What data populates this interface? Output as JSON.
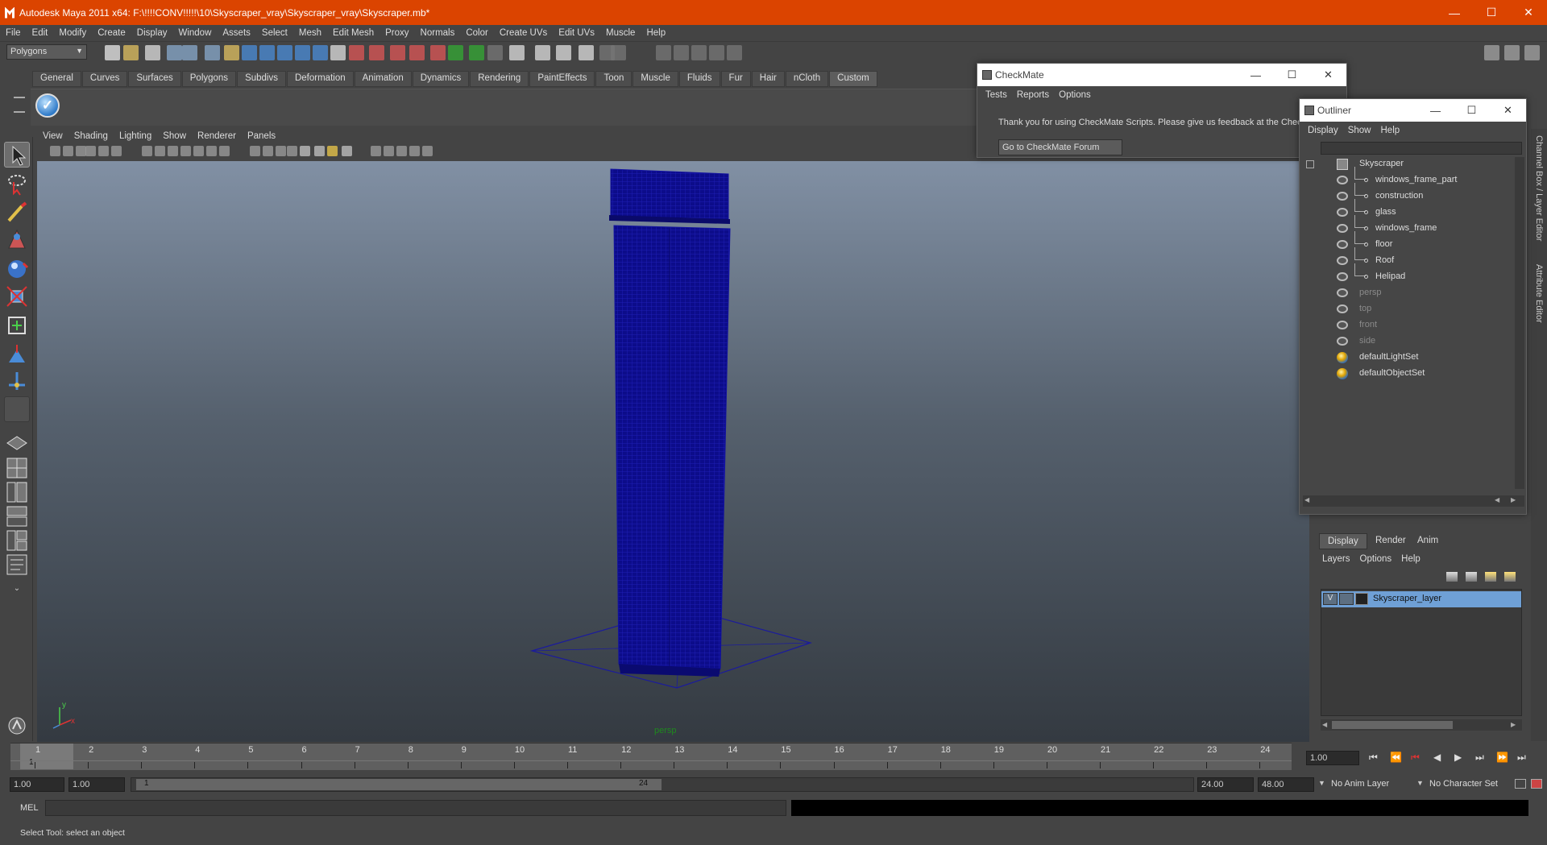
{
  "titlebar": {
    "title": "Autodesk Maya 2011 x64: F:\\!!!!CONV!!!!!\\10\\Skyscraper_vray\\Skyscraper_vray\\Skyscraper.mb*"
  },
  "menubar": [
    "File",
    "Edit",
    "Modify",
    "Create",
    "Display",
    "Window",
    "Assets",
    "Select",
    "Mesh",
    "Edit Mesh",
    "Proxy",
    "Normals",
    "Color",
    "Create UVs",
    "Edit UVs",
    "Muscle",
    "Help"
  ],
  "mode_combo": "Polygons",
  "shelf_tabs": [
    "General",
    "Curves",
    "Surfaces",
    "Polygons",
    "Subdivs",
    "Deformation",
    "Animation",
    "Dynamics",
    "Rendering",
    "PaintEffects",
    "Toon",
    "Muscle",
    "Fluids",
    "Fur",
    "Hair",
    "nCloth",
    "Custom"
  ],
  "shelf_active": "Custom",
  "panel_menu": [
    "View",
    "Shading",
    "Lighting",
    "Show",
    "Renderer",
    "Panels"
  ],
  "viewport": {
    "camera_label": "persp",
    "axis_y": "y",
    "axis_x": "x"
  },
  "timeline": {
    "frames": [
      "1",
      "2",
      "3",
      "4",
      "5",
      "6",
      "7",
      "8",
      "9",
      "10",
      "11",
      "12",
      "13",
      "14",
      "15",
      "16",
      "17",
      "18",
      "19",
      "20",
      "21",
      "22",
      "23",
      "24"
    ],
    "current_frame": "1",
    "current_time_field": "1.00"
  },
  "range": {
    "start": "1.00",
    "inner_start": "1.00",
    "slider_start": "1",
    "slider_end": "24",
    "end": "24.00",
    "outer_end": "48.00",
    "anim_layer": "No Anim Layer",
    "char_set": "No Character Set"
  },
  "mel": {
    "label": "MEL"
  },
  "help_line": "Select Tool: select an object",
  "checkmate": {
    "title": "CheckMate",
    "menu": [
      "Tests",
      "Reports",
      "Options"
    ],
    "message": "Thank you for using CheckMate Scripts. Please give us feedback at the Check",
    "button": "Go to CheckMate Forum"
  },
  "outliner": {
    "title": "Outliner",
    "menu": [
      "Display",
      "Show",
      "Help"
    ],
    "root": "Skyscraper",
    "children": [
      "windows_frame_part",
      "construction",
      "glass",
      "windows_frame",
      "floor",
      "Roof",
      "Helipad"
    ],
    "cameras": [
      "persp",
      "top",
      "front",
      "side"
    ],
    "sets": [
      "defaultLightSet",
      "defaultObjectSet"
    ]
  },
  "layer_editor": {
    "tabs": [
      "Display",
      "Render",
      "Anim"
    ],
    "active_tab": "Display",
    "menu": [
      "Layers",
      "Options",
      "Help"
    ],
    "layer": {
      "visibility": "V",
      "name": "Skyscraper_layer"
    }
  },
  "side_tabs": [
    "Channel Box / Layer Editor",
    "Attribute Editor"
  ]
}
